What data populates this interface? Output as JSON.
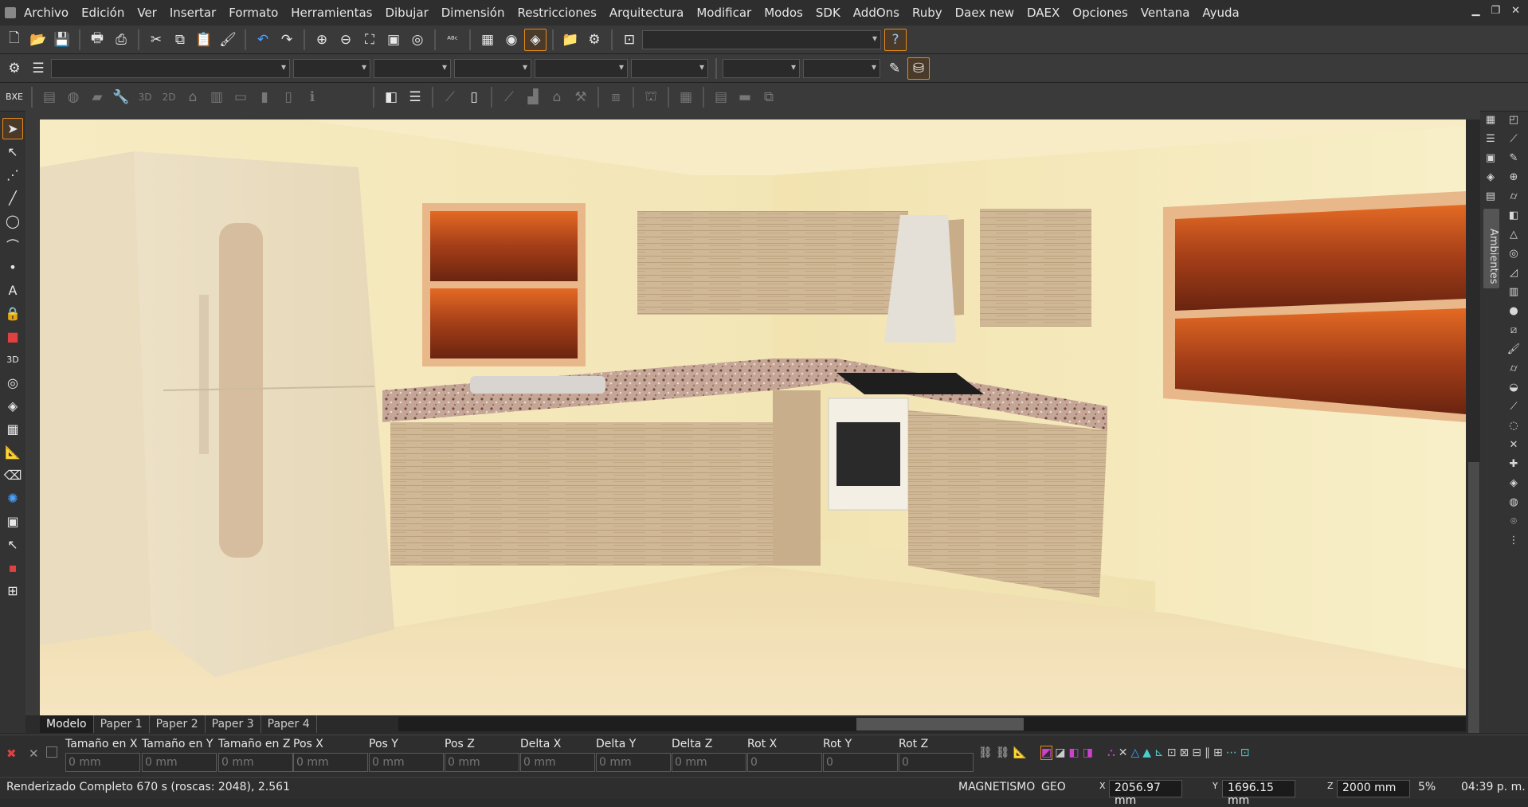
{
  "menubar": {
    "items": [
      "Archivo",
      "Edición",
      "Ver",
      "Insertar",
      "Formato",
      "Herramientas",
      "Dibujar",
      "Dimensión",
      "Restricciones",
      "Arquitectura",
      "Modificar",
      "Modos",
      "SDK",
      "AddOns",
      "Ruby",
      "Daex new",
      "DAEX",
      "Opciones",
      "Ventana",
      "Ayuda"
    ]
  },
  "window_controls": {
    "minimize": "▁",
    "restore": "❐",
    "close": "✕"
  },
  "toolbar3": {
    "bxe": "BXE",
    "btn3d": "3D",
    "btn2d": "2D"
  },
  "side_panel": {
    "ambientes_label": "Ambientes"
  },
  "tabs": {
    "modelo": "Modelo",
    "paper1": "Paper 1",
    "paper2": "Paper 2",
    "paper3": "Paper 3",
    "paper4": "Paper 4"
  },
  "coords": {
    "fields": [
      {
        "label": "Tamaño en X",
        "value": "0 mm"
      },
      {
        "label": "Tamaño en Y",
        "value": "0 mm"
      },
      {
        "label": "Tamaño en Z",
        "value": "0 mm"
      },
      {
        "label": "Pos X",
        "value": "0 mm"
      },
      {
        "label": "Pos Y",
        "value": "0 mm"
      },
      {
        "label": "Pos Z",
        "value": "0 mm"
      },
      {
        "label": "Delta X",
        "value": "0 mm"
      },
      {
        "label": "Delta Y",
        "value": "0 mm"
      },
      {
        "label": "Delta Z",
        "value": "0 mm"
      },
      {
        "label": "Rot X",
        "value": "0"
      },
      {
        "label": "Rot Y",
        "value": "0"
      },
      {
        "label": "Rot Z",
        "value": "0"
      }
    ]
  },
  "status": {
    "message": "Renderizado Completo 670 s (roscas: 2048), 2.561",
    "magnetismo": "MAGNETISMO",
    "geo": "GEO",
    "x_value": "2056.97 mm",
    "y_value": "1696.15 mm",
    "z_value": "2000 mm",
    "zoom": "5%",
    "time": "04:39 p. m."
  },
  "colors": {
    "accent": "#e88a1a",
    "wall": "#f3e6b8",
    "wood": "#cdb694",
    "counter": "#b89a88"
  }
}
